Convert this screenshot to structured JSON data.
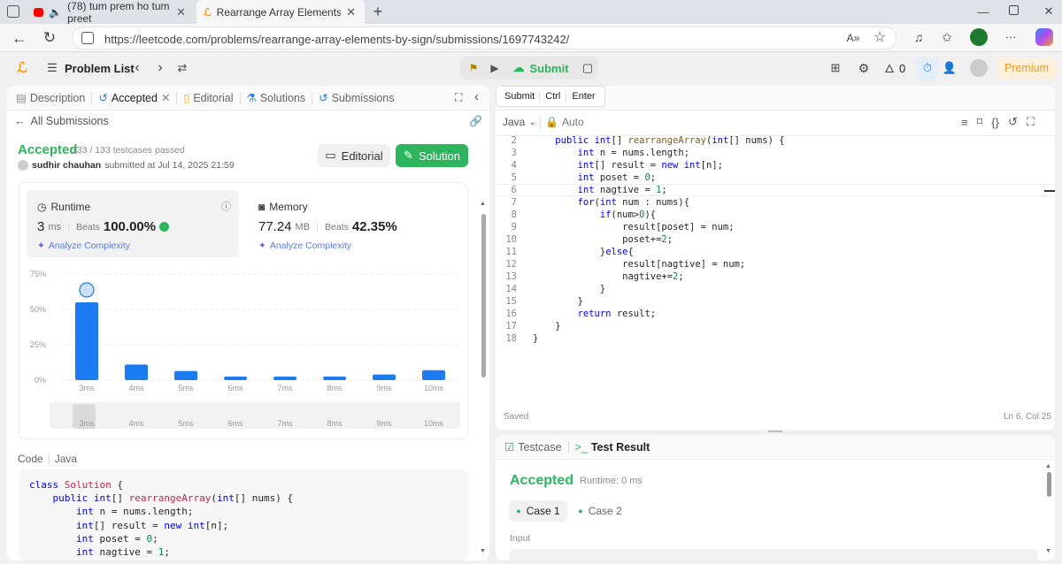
{
  "browser": {
    "tabs": [
      {
        "label": "(78) tum prem ho tum preet"
      },
      {
        "label": "Rearrange Array Elements by Sign"
      }
    ],
    "url": "https://leetcode.com/problems/rearrange-array-elements-by-sign/submissions/1697743242/"
  },
  "nav": {
    "problem_list": "Problem List",
    "submit": "Submit",
    "premium": "Premium",
    "streak": "0"
  },
  "left": {
    "tabs": {
      "description": "Description",
      "accepted": "Accepted",
      "editorial": "Editorial",
      "solutions": "Solutions",
      "submissions": "Submissions"
    },
    "all_submissions": "All Submissions",
    "status": "Accepted",
    "testcases": "133 / 133 testcases passed",
    "user": "sudhir chauhan",
    "submitted_at": "submitted at Jul 14, 2025 21:59",
    "editorial_btn": "Editorial",
    "solution_btn": "Solution",
    "runtime": {
      "label": "Runtime",
      "value": "3",
      "unit": "ms",
      "beats_label": "Beats",
      "beats": "100.00%",
      "analyze": "Analyze Complexity"
    },
    "memory": {
      "label": "Memory",
      "value": "77.24",
      "unit": "MB",
      "beats_label": "Beats",
      "beats": "42.35%",
      "analyze": "Analyze Complexity"
    },
    "code_label": "Code",
    "code_lang": "Java",
    "code_lines": [
      "class Solution {",
      "    public int[] rearrangeArray(int[] nums) {",
      "        int n = nums.length;",
      "        int[] result = new int[n];",
      "        int poset = 0;",
      "        int nagtive = 1;"
    ]
  },
  "chart_data": {
    "type": "bar",
    "categories": [
      "3ms",
      "4ms",
      "5ms",
      "6ms",
      "7ms",
      "8ms",
      "9ms",
      "10ms"
    ],
    "values": [
      55,
      11,
      6.5,
      2.5,
      2.5,
      2.5,
      4,
      7
    ],
    "yticks": [
      "0%",
      "25%",
      "50%",
      "75%"
    ],
    "ylim": [
      0,
      75
    ],
    "highlight": "3ms",
    "bar_color": "#1a7cf0"
  },
  "editor": {
    "tooltip": {
      "submit": "Submit",
      "ctrl": "Ctrl",
      "enter": "Enter"
    },
    "lang": "Java",
    "auto": "Auto",
    "lines": [
      {
        "n": "2",
        "t": "    public int[] rearrangeArray(int[] nums) {"
      },
      {
        "n": "3",
        "t": "        int n = nums.length;"
      },
      {
        "n": "4",
        "t": "        int[] result = new int[n];"
      },
      {
        "n": "5",
        "t": "        int poset = 0;"
      },
      {
        "n": "6",
        "t": "        int nagtive = 1;"
      },
      {
        "n": "7",
        "t": "        for(int num : nums){"
      },
      {
        "n": "8",
        "t": "            if(num>0){"
      },
      {
        "n": "9",
        "t": "                result[poset] = num;"
      },
      {
        "n": "10",
        "t": "                poset+=2;"
      },
      {
        "n": "11",
        "t": "            }else{"
      },
      {
        "n": "12",
        "t": "                result[nagtive] = num;"
      },
      {
        "n": "13",
        "t": "                nagtive+=2;"
      },
      {
        "n": "14",
        "t": "            }"
      },
      {
        "n": "15",
        "t": "        }"
      },
      {
        "n": "16",
        "t": "        return result;"
      },
      {
        "n": "17",
        "t": "    }"
      },
      {
        "n": "18",
        "t": "}"
      }
    ],
    "saved": "Saved",
    "cursor": "Ln 6, Col 25"
  },
  "result": {
    "tab_testcase": "Testcase",
    "tab_result": "Test Result",
    "status": "Accepted",
    "runtime": "Runtime: 0 ms",
    "case1": "Case 1",
    "case2": "Case 2",
    "input": "Input"
  }
}
